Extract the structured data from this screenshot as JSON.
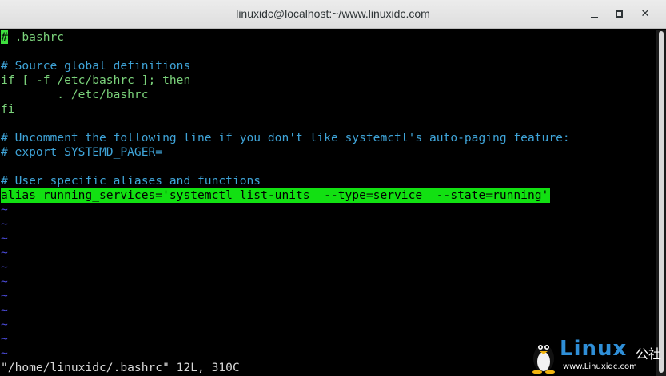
{
  "window": {
    "title": "linuxidc@localhost:~/www.linuxidc.com",
    "minimize_label": "",
    "maximize_label": "",
    "close_label": "✕"
  },
  "editor": {
    "cursor_char": "#",
    "lines": [
      " .bashrc",
      "",
      "# Source global definitions",
      "if [ -f /etc/bashrc ]; then",
      "        . /etc/bashrc",
      "fi",
      "",
      "# Uncomment the following line if you don't like systemctl's auto-paging feature:",
      "# export SYSTEMD_PAGER=",
      "",
      "# User specific aliases and functions",
      "alias running_services='systemctl list-units  --type=service  --state=running'",
      "~",
      "~",
      "~",
      "~",
      "~",
      "~",
      "~",
      "~",
      "~",
      "~",
      "~"
    ],
    "status_line": "\"/home/linuxidc/.bashrc\" 12L, 310C"
  },
  "watermark": {
    "brand": "Linux",
    "cn": "公社",
    "url": "www.Linuxidc.com"
  },
  "colors": {
    "comment": "#3fa4d8",
    "code": "#7bd27b",
    "highlight": "#12e012",
    "tilde": "#4a4ad8"
  }
}
